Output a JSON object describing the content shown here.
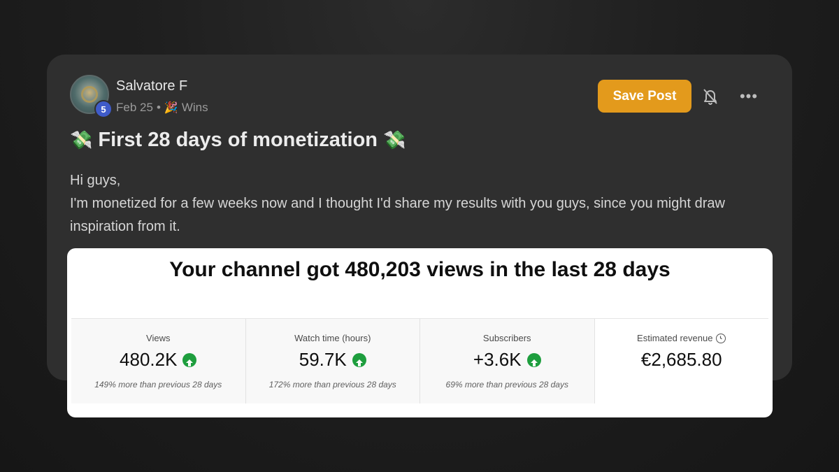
{
  "post": {
    "author": "Salvatore F",
    "level": "5",
    "date": "Feb 25",
    "separator": "•",
    "category_icon": "party-popper-icon",
    "category": "Wins",
    "save_label": "Save Post",
    "more_label": "•••",
    "title_icon": "money-with-wings-icon",
    "title": "First 28 days of monetization",
    "body_line1": "Hi guys,",
    "body_line2": "I'm monetized for a few weeks now and I thought I'd share my results with you guys, since you might draw inspiration from it."
  },
  "analytics": {
    "headline": "Your channel got 480,203 views in the last 28 days",
    "stats": [
      {
        "label": "Views",
        "value": "480.2K",
        "note": "149% more than previous 28 days",
        "trend": "up"
      },
      {
        "label": "Watch time (hours)",
        "value": "59.7K",
        "note": "172% more than previous 28 days",
        "trend": "up"
      },
      {
        "label": "Subscribers",
        "value": "+3.6K",
        "note": "69% more than previous 28 days",
        "trend": "up"
      },
      {
        "label": "Estimated revenue",
        "value": "€2,685.80",
        "note": "",
        "trend": ""
      }
    ]
  },
  "colors": {
    "accent": "#e39a1c",
    "level_badge": "#3f5bc9",
    "trend_up": "#1e9e3e"
  }
}
